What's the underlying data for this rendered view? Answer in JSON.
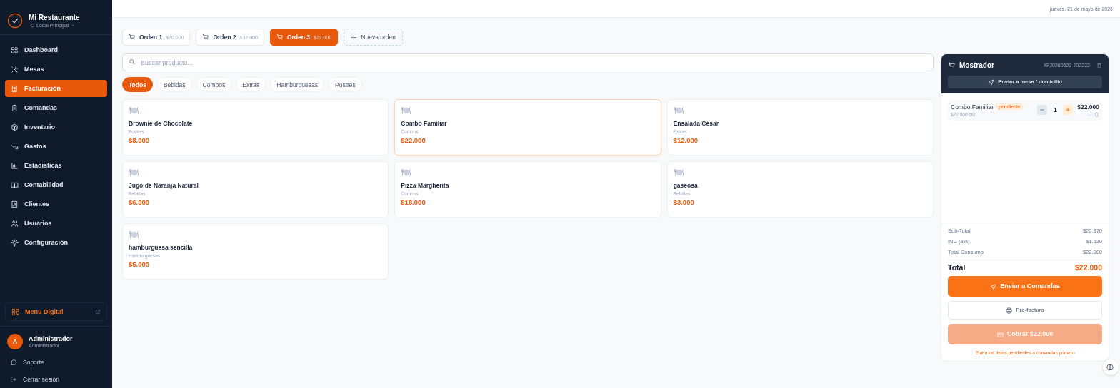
{
  "brand": {
    "name": "Mi Restaurante",
    "location": "Local Principal"
  },
  "nav": [
    {
      "label": "Dashboard",
      "selected": false
    },
    {
      "label": "Mesas",
      "selected": false
    },
    {
      "label": "Facturación",
      "selected": true
    },
    {
      "label": "Comandas",
      "selected": false
    },
    {
      "label": "Inventario",
      "selected": false
    },
    {
      "label": "Gastos",
      "selected": false
    },
    {
      "label": "Estadisticas",
      "selected": false
    },
    {
      "label": "Contabilidad",
      "selected": false
    },
    {
      "label": "Clientes",
      "selected": false
    },
    {
      "label": "Usuarios",
      "selected": false
    },
    {
      "label": "Configuración",
      "selected": false
    }
  ],
  "menu_link": "Menu Digital",
  "user": {
    "initial": "A",
    "name": "Administrador",
    "role": "Administrador"
  },
  "footer_links": [
    "Soporte",
    "Cerrar sesión"
  ],
  "date": "jueves, 21 de mayo de 2026",
  "order_tabs": [
    {
      "label": "Orden 1",
      "amount": "$70.000",
      "selected": false
    },
    {
      "label": "Orden 2",
      "amount": "$32.000",
      "selected": false
    },
    {
      "label": "Orden 3",
      "amount": "$22.000",
      "selected": true
    }
  ],
  "new_order": "Nueva orden",
  "search": {
    "placeholder": "Buscar producto..."
  },
  "categories": [
    {
      "label": "Todos",
      "selected": true
    },
    {
      "label": "Bebidas",
      "selected": false
    },
    {
      "label": "Combos",
      "selected": false
    },
    {
      "label": "Extras",
      "selected": false
    },
    {
      "label": "Hamburguesas",
      "selected": false
    },
    {
      "label": "Postres",
      "selected": false
    }
  ],
  "products": [
    {
      "name": "Brownie de Chocolate",
      "category": "Postres",
      "price": "$8.000",
      "selected": false
    },
    {
      "name": "Combo Familiar",
      "category": "Combos",
      "price": "$22.000",
      "selected": true
    },
    {
      "name": "Ensalada César",
      "category": "Extras",
      "price": "$12.000",
      "selected": false
    },
    {
      "name": "Jugo de Naranja Natural",
      "category": "Bebidas",
      "price": "$6.000",
      "selected": false
    },
    {
      "name": "Pizza Margherita",
      "category": "Combos",
      "price": "$18.000",
      "selected": false
    },
    {
      "name": "gaseosa",
      "category": "Bebidas",
      "price": "$3.000",
      "selected": false
    },
    {
      "name": "hamburguesa sencilla",
      "category": "Hamburguesas",
      "price": "$5.000",
      "selected": false
    }
  ],
  "ticket": {
    "title": "Mostrador",
    "number": "#F20260522-702222",
    "send_to_table": "Enviar a mesa / domicilio",
    "items": [
      {
        "name": "Combo Familiar",
        "status": "pendiente",
        "unit_price": "$22.000 c/u",
        "quantity": "1",
        "total": "$22.000"
      }
    ],
    "totals": [
      {
        "label": "Sub-Total",
        "value": "$20.370"
      },
      {
        "label": "INC (8%)",
        "value": "$1.630"
      },
      {
        "label": "Total Consumo",
        "value": "$22.000"
      }
    ],
    "total": {
      "label": "Total",
      "value": "$22.000"
    },
    "send_button": "Enviar a Comandas",
    "prebill_button": "Pre-factura",
    "charge_button": {
      "label": "Cobrar $22.000",
      "disabled": true
    },
    "note": "Envía los ítems pendientes a comandas primero"
  }
}
